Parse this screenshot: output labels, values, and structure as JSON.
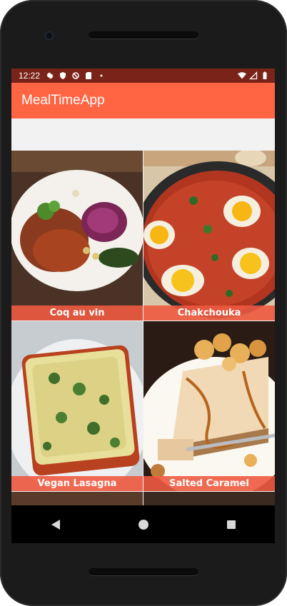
{
  "status_bar": {
    "time": "12:22",
    "left_icons": [
      "settings-icon",
      "shield-icon",
      "no-symbol-icon",
      "sd-card-icon",
      "dot-icon"
    ],
    "right_icons": [
      "wifi-icon",
      "signal-icon",
      "battery-icon"
    ]
  },
  "app_bar": {
    "title": "MealTimeApp"
  },
  "recipes": [
    {
      "label": "Coq au vin"
    },
    {
      "label": "Chakchouka"
    },
    {
      "label": "Vegan Lasagna"
    },
    {
      "label": "Salted Caramel Cheescake"
    }
  ],
  "nav": {
    "back": "back-icon",
    "home": "home-icon",
    "recents": "recents-icon"
  },
  "colors": {
    "primary": "#ff6542",
    "primary_dark": "#7a2318",
    "label_bg": "#ee5a40"
  }
}
